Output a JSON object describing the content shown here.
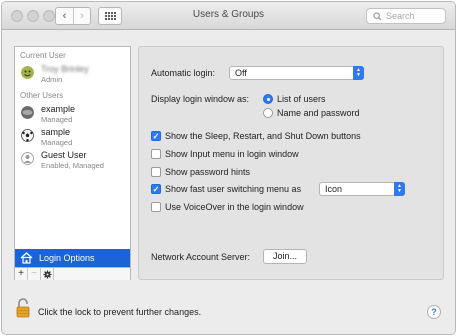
{
  "window": {
    "title": "Users & Groups"
  },
  "toolbar": {
    "back_icon": "chevron-left-icon",
    "forward_icon": "chevron-right-icon",
    "show_all_icon": "grid-icon",
    "search_placeholder": "Search"
  },
  "sidebar": {
    "current_user_label": "Current User",
    "current_user": {
      "name": "Troy Brinley",
      "role": "Admin"
    },
    "other_users_label": "Other Users",
    "other_users": [
      {
        "name": "example",
        "role": "Managed"
      },
      {
        "name": "sample",
        "role": "Managed"
      },
      {
        "name": "Guest User",
        "role": "Enabled, Managed"
      }
    ],
    "login_options_label": "Login Options",
    "add_symbol": "+",
    "remove_symbol": "−",
    "action_symbol": "✱"
  },
  "panel": {
    "automatic_login_label": "Automatic login:",
    "automatic_login_value": "Off",
    "display_login_label": "Display login window as:",
    "display_options": [
      "List of users",
      "Name and password"
    ],
    "display_selected": 0,
    "checkboxes": [
      {
        "label": "Show the Sleep, Restart, and Shut Down buttons",
        "checked": true
      },
      {
        "label": "Show Input menu in login window",
        "checked": false
      },
      {
        "label": "Show password hints",
        "checked": false
      },
      {
        "label": "Show fast user switching menu as",
        "checked": true
      },
      {
        "label": "Use VoiceOver in the login window",
        "checked": false
      }
    ],
    "fast_switching_value": "Icon",
    "network_server_label": "Network Account Server:",
    "join_button_label": "Join..."
  },
  "footer": {
    "lock_text": "Click the lock to prevent further changes.",
    "help_label": "?"
  },
  "colors": {
    "accent": "#1d62d6",
    "control_blue": "#2f7af0"
  }
}
